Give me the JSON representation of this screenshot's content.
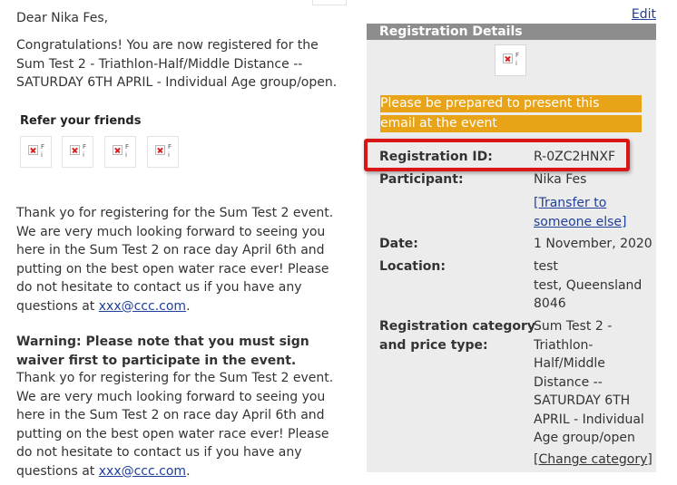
{
  "email": {
    "greeting": "Dear Nika Fes,",
    "congrats_lines": [
      "Congratulations! You are now registered for the",
      "Sum Test 2 - Triathlon-Half/Middle Distance --",
      "SATURDAY 6TH APRIL - Individual Age group/open."
    ],
    "refer_title": "Refer your friends",
    "thanks_lines": [
      "Thank yo for registering for the Sum Test 2 event.",
      "We are very much looking forward to seeing you",
      "here in the Sum Test 2 on race day April 6th and",
      "putting on the best open water race ever! Please",
      "do not hesitate to contact us if you have any"
    ],
    "questions_prefix": "questions at ",
    "contact_email": "xxx@ccc.com",
    "questions_suffix": ".",
    "warning_lines": [
      "Warning: Please note that you must sign",
      "waiver first to participate in the event."
    ],
    "thanks2_lines": [
      "Thank yo for registering for the Sum Test 2 event.",
      "We are very much looking forward to seeing you",
      "here in the Sum Test 2 on race day April 6th and",
      "putting on the best open water race ever! Please",
      "do not hesitate to contact us if you have any"
    ]
  },
  "panel": {
    "edit_label": "Edit",
    "title": "Registration Details",
    "notice_lines": [
      "Please be prepared to present this",
      "email at the event"
    ],
    "registration_id_label": "Registration ID:",
    "registration_id": "R-0ZC2HNXF",
    "participant_label": "Participant:",
    "participant": "Nika Fes",
    "transfer_lines": [
      "[Transfer to",
      "someone else]"
    ],
    "date_label": "Date:",
    "date": "1 November, 2020",
    "location_label": "Location:",
    "location_lines": [
      "test",
      "test, Queensland",
      "8046"
    ],
    "category_label_lines": [
      "Registration category",
      "and price type:"
    ],
    "category_lines": [
      "Sum Test 2 -",
      "Triathlon-",
      "Half/Middle",
      "Distance --",
      "SATURDAY 6TH",
      "APRIL - Individual",
      "Age group/open"
    ],
    "change_category": "[Change category]"
  },
  "colors": {
    "panel_bg": "#ececec",
    "panel_header": "#8d8d8d",
    "notice_bg": "#e8a317",
    "highlight_border": "#d91515",
    "link": "#1f3f99"
  }
}
